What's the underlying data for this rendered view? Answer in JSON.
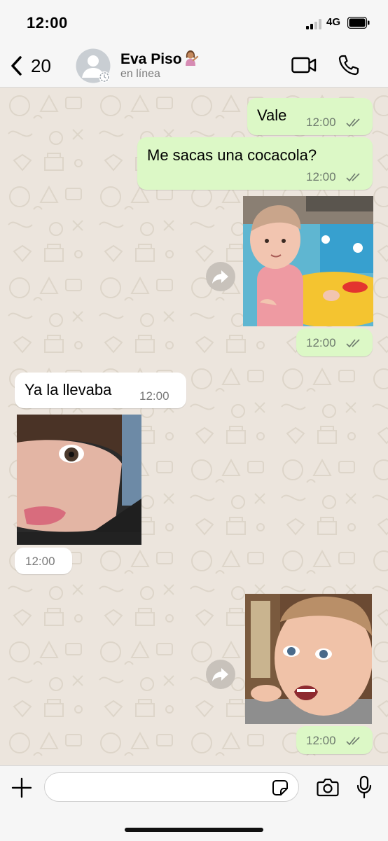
{
  "status_bar": {
    "time": "12:00",
    "network": "4G"
  },
  "header": {
    "back_count": "20",
    "contact_name": "Eva Piso",
    "contact_status": "en línea"
  },
  "messages": [
    {
      "direction": "outgoing",
      "text": "Vale",
      "time": "12:00",
      "status": "read"
    },
    {
      "direction": "outgoing",
      "text": "Me sacas una cocacola?",
      "time": "12:00",
      "status": "read"
    },
    {
      "direction": "outgoing",
      "type": "image",
      "subject": "baby in yellow pool float",
      "time": "12:00",
      "status": "read"
    },
    {
      "direction": "incoming",
      "text": "Ya la llevaba",
      "time": "12:00"
    },
    {
      "direction": "incoming",
      "type": "image",
      "subject": "toddler sticking tongue out",
      "time": "12:00"
    },
    {
      "direction": "outgoing",
      "type": "image",
      "subject": "smiling toddler close-up",
      "time": "12:00",
      "status": "read"
    }
  ],
  "input": {
    "value": "",
    "placeholder": ""
  },
  "colors": {
    "outgoing_bubble": "#dcf8c6",
    "incoming_bubble": "#ffffff",
    "chat_background": "#ece5dd",
    "bar_background": "#f6f6f6"
  },
  "icons": {
    "back": "chevron-left-icon",
    "video": "video-camera-icon",
    "call": "phone-icon",
    "forward": "forward-arrow-icon",
    "attach": "plus-icon",
    "sticker": "sticker-icon",
    "camera": "camera-icon",
    "mic": "microphone-icon",
    "read": "double-check-icon"
  }
}
